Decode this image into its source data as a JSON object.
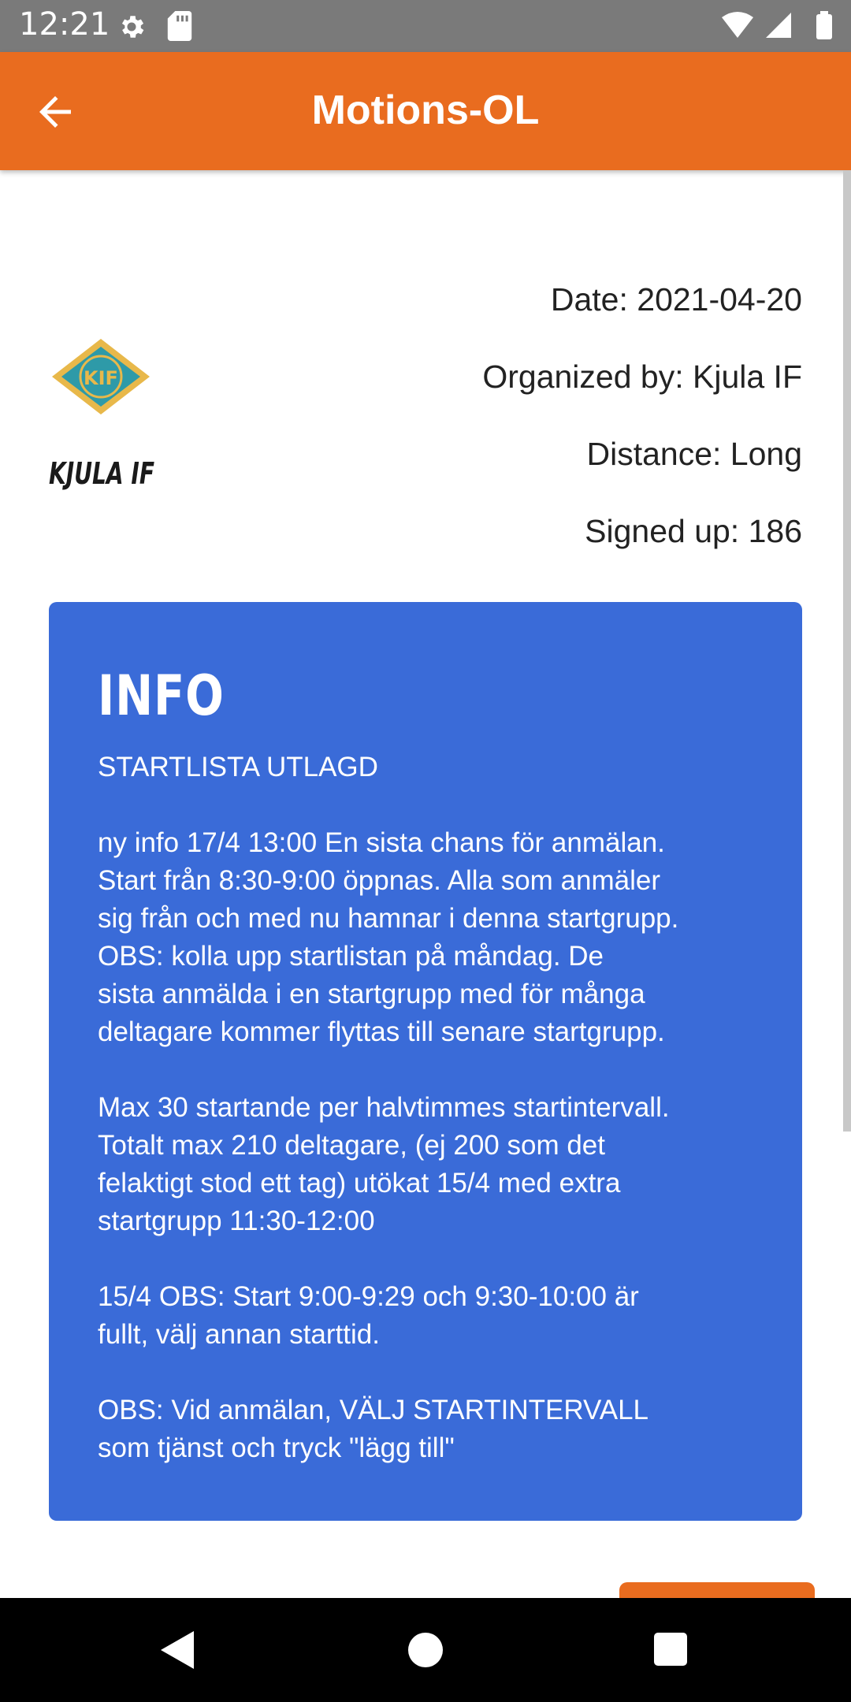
{
  "status_bar": {
    "time": "12:21",
    "icons": [
      "gear-icon",
      "sd-card-icon",
      "wifi-icon",
      "signal-icon",
      "battery-icon"
    ]
  },
  "app_bar": {
    "title": "Motions-OL",
    "back_icon": "arrow-left-icon",
    "color": "#e96c1f"
  },
  "event": {
    "logo_text": "KJULA IF",
    "date": "Date: 2021-04-20",
    "organizer": "Organized by: Kjula IF",
    "distance": "Distance: Long",
    "signed_up": "Signed up: 186"
  },
  "info": {
    "heading": "INFO",
    "color": "#3a6bd8",
    "paragraphs": [
      "STARTLISTA UTLAGD",
      "ny info 17/4  13:00   En sista chans för anmälan.\nStart från 8:30-9:00 öppnas. Alla som anmäler\nsig från och med nu hamnar i denna startgrupp.\nOBS: kolla upp startlistan på måndag. De\nsista anmälda i en startgrupp med för många\ndeltagare kommer flyttas till senare startgrupp.",
      "Max 30 startande per halvtimmes startintervall.\nTotalt max 210 deltagare, (ej 200 som det\nfelaktigt stod ett tag) utökat 15/4 med extra\nstartgrupp 11:30-12:00",
      "15/4  OBS:  Start 9:00-9:29 och 9:30-10:00 är\nfullt, välj annan starttid.",
      "OBS:  Vid anmälan,  VÄLJ STARTINTERVALL\nsom tjänst och tryck \"lägg till\""
    ]
  },
  "nav_bar": {
    "icons": [
      "back-triangle-icon",
      "home-circle-icon",
      "recents-square-icon"
    ]
  }
}
